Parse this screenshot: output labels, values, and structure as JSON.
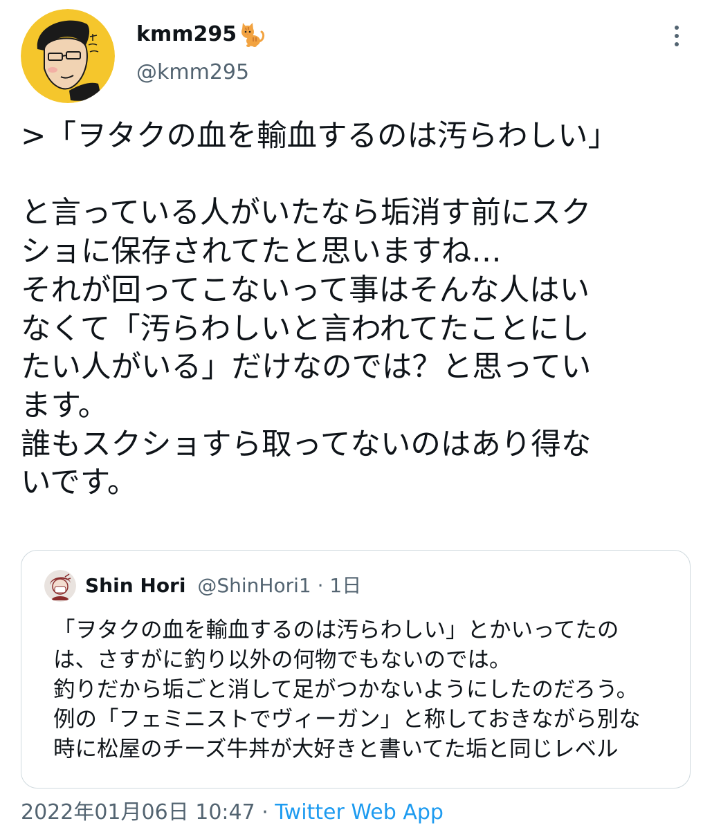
{
  "tweet": {
    "author": {
      "display_name": "kmm295",
      "handle": "@kmm295",
      "name_emoji": "cat-icon"
    },
    "text": ">「ヲタクの血を輸血するのは汚らわしい」\n\nと言っている人がいたなら垢消す前にスク\nショに保存されてたと思いますね…\nそれが回ってこないって事はそんな人はい\nなくて「汚らわしいと言われてたことにし\nたい人がいる」だけなのでは？と思ってい\nます。\n誰もスクショすら取ってないのはあり得な\nいです。",
    "timestamp": "2022年01月06日 10:47",
    "separator": " · ",
    "source": "Twitter Web App"
  },
  "quote": {
    "author": {
      "display_name": "Shin Hori",
      "handle": "@ShinHori1"
    },
    "dot": " · ",
    "relative_time": "1日",
    "text": "「ヲタクの血を輸血するのは汚らわしい」とかいってたの\nは、さすがに釣り以外の何物でもないのでは。\n釣りだから垢ごと消して足がつかないようにしたのだろう。\n例の「フェミニストでヴィーガン」と称しておきながら別な\n時に松屋のチーズ牛丼が大好きと書いてた垢と同じレベル"
  },
  "colors": {
    "text_primary": "#0f1419",
    "text_secondary": "#536471",
    "link": "#1d9bf0",
    "border": "#cfd9de",
    "avatar_bg": "#f5c62c"
  }
}
